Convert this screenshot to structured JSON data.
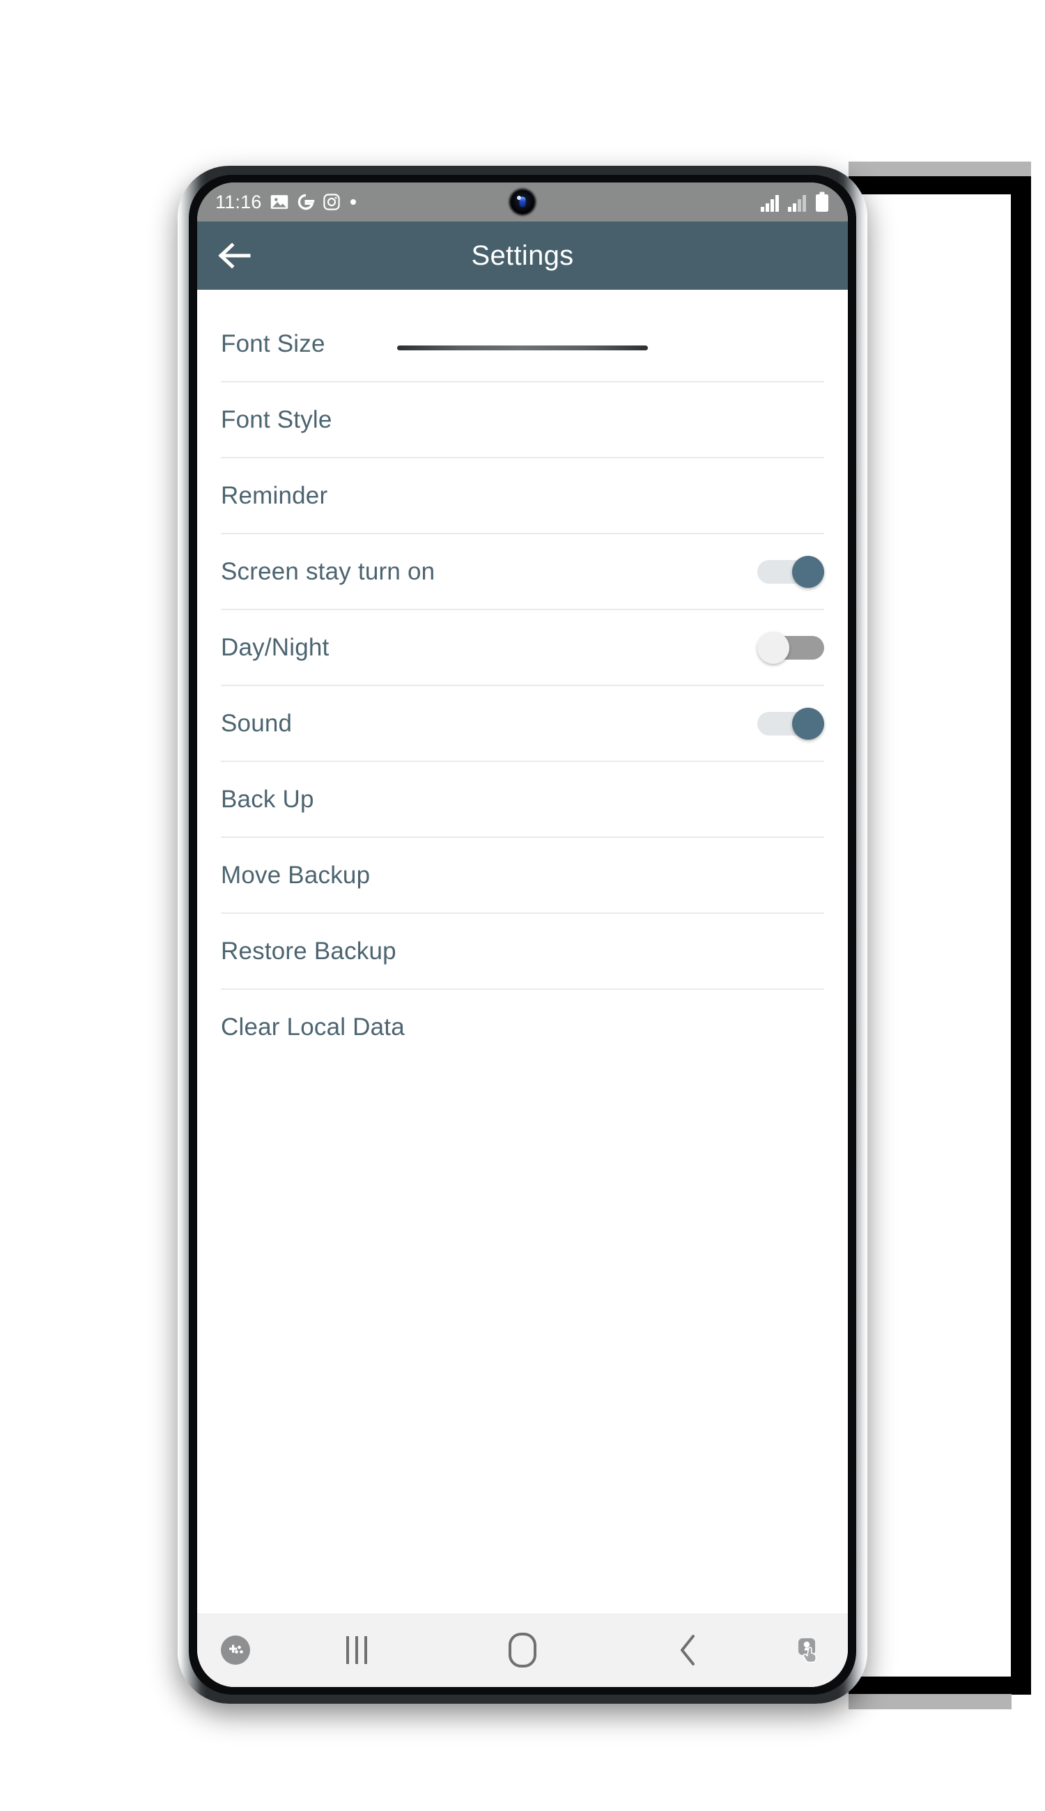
{
  "status_bar": {
    "time": "11:16",
    "left_icons": [
      "gallery-icon",
      "google-icon",
      "instagram-icon",
      "dot-icon"
    ],
    "right_icons": [
      "signal-1-icon",
      "signal-2-icon",
      "battery-icon"
    ],
    "background_color": "#8a8b8b",
    "text_color": "#ffffff"
  },
  "app_bar": {
    "title": "Settings",
    "back_icon": "arrow-left-icon",
    "background_color": "#47606b",
    "text_color": "#ffffff"
  },
  "settings": {
    "rows": [
      {
        "label": "Font Size",
        "type": "nav"
      },
      {
        "label": "Font Style",
        "type": "nav"
      },
      {
        "label": "Reminder",
        "type": "nav"
      },
      {
        "label": "Screen stay turn on",
        "type": "toggle",
        "state": "on"
      },
      {
        "label": "Day/Night",
        "type": "toggle",
        "state": "off"
      },
      {
        "label": "Sound",
        "type": "toggle",
        "state": "on"
      },
      {
        "label": "Back Up",
        "type": "nav"
      },
      {
        "label": "Move Backup",
        "type": "nav"
      },
      {
        "label": "Restore Backup",
        "type": "nav"
      },
      {
        "label": "Clear Local Data",
        "type": "nav"
      }
    ],
    "label_color": "#4c6470",
    "divider_color": "#e8eaec",
    "toggle_on_color": "#4f7083",
    "toggle_off_color": "#9b9b9b",
    "background_color": "#ffffff"
  },
  "nav_bar": {
    "items": [
      {
        "name": "game-booster-icon"
      },
      {
        "name": "recents-icon"
      },
      {
        "name": "home-icon"
      },
      {
        "name": "back-nav-icon"
      },
      {
        "name": "touch-assistant-icon"
      }
    ],
    "background_color": "#f2f2f2",
    "icon_color": "#6f7072"
  }
}
